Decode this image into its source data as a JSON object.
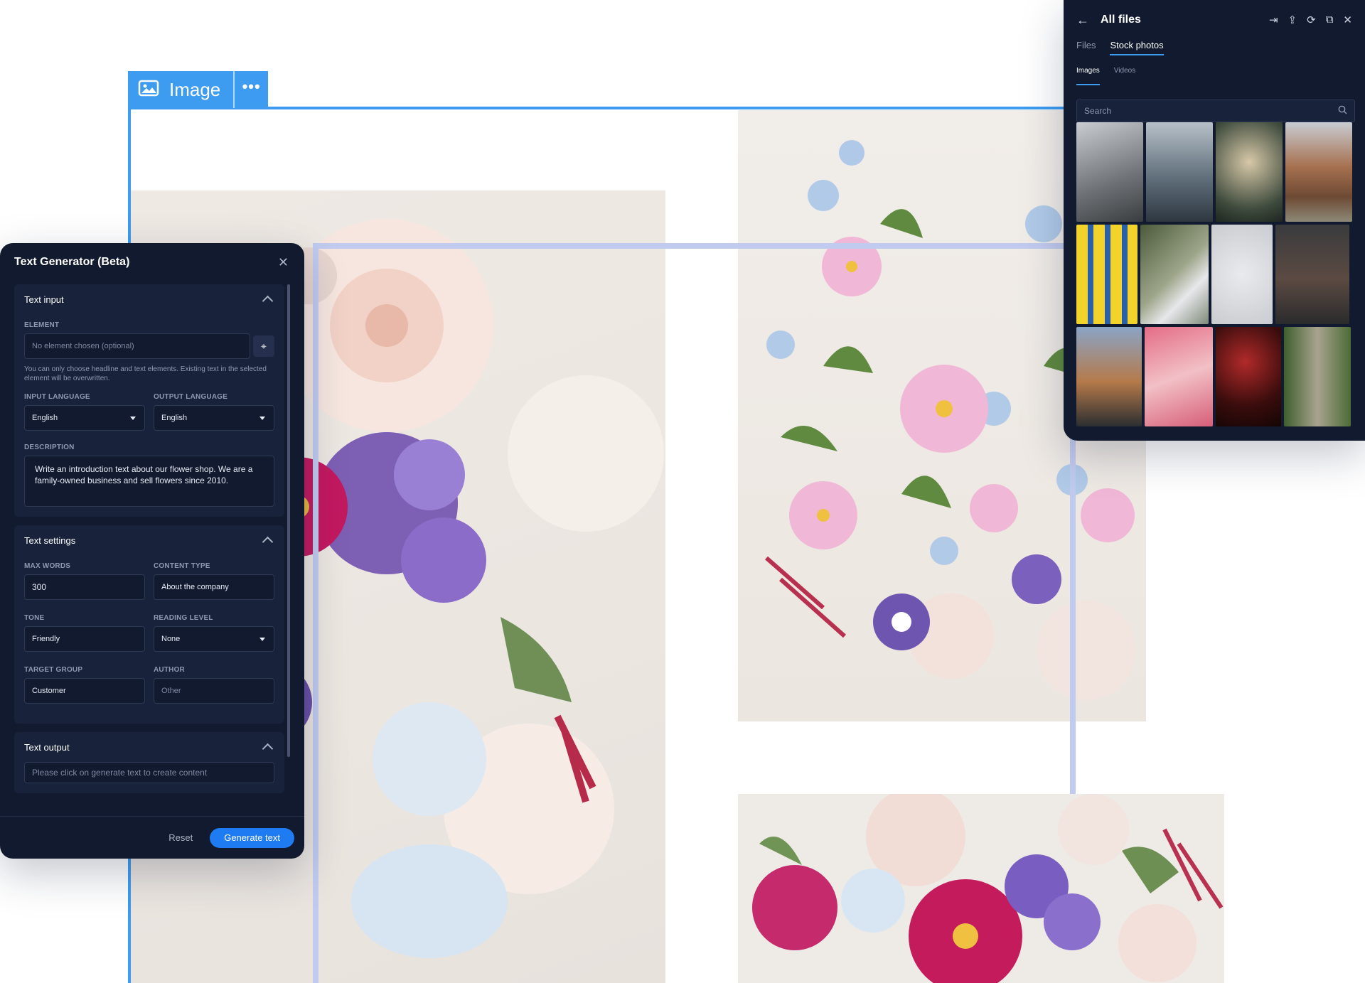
{
  "image_toolbar": {
    "label": "Image",
    "more": "•••"
  },
  "text_generator": {
    "title": "Text Generator (Beta)",
    "sections": {
      "text_input": {
        "title": "Text input",
        "element_label": "ELEMENT",
        "element_placeholder": "No element chosen (optional)",
        "hint": "You can only choose headline and text elements. Existing text in the selected element will be overwritten.",
        "input_language_label": "INPUT LANGUAGE",
        "input_language": "English",
        "output_language_label": "OUTPUT LANGUAGE",
        "output_language": "English",
        "description_label": "DESCRIPTION",
        "description": "Write an introduction text about our flower shop. We are a family-owned business and sell flowers since 2010."
      },
      "text_settings": {
        "title": "Text settings",
        "max_words_label": "MAX WORDS",
        "max_words": "300",
        "content_type_label": "CONTENT TYPE",
        "content_type": "About the company",
        "tone_label": "TONE",
        "tone": "Friendly",
        "reading_level_label": "READING LEVEL",
        "reading_level": "None",
        "target_group_label": "TARGET GROUP",
        "target_group": "Customer",
        "author_label": "AUTHOR",
        "author_placeholder": "Other"
      },
      "text_output": {
        "title": "Text output",
        "placeholder": "Please click on generate text to create content"
      }
    },
    "reset_label": "Reset",
    "generate_label": "Generate text"
  },
  "files_panel": {
    "title": "All files",
    "tabs": [
      "Files",
      "Stock photos"
    ],
    "active_tab": "Stock photos",
    "subtabs": [
      "Images",
      "Videos"
    ],
    "active_subtab": "Images",
    "search_placeholder": "Search"
  },
  "colors": {
    "accent": "#3d9bf0",
    "panel_bg": "#111a2e",
    "section_bg": "#18223a",
    "primary_button": "#1f7bf2",
    "selection_frame": "#c1cbef"
  }
}
